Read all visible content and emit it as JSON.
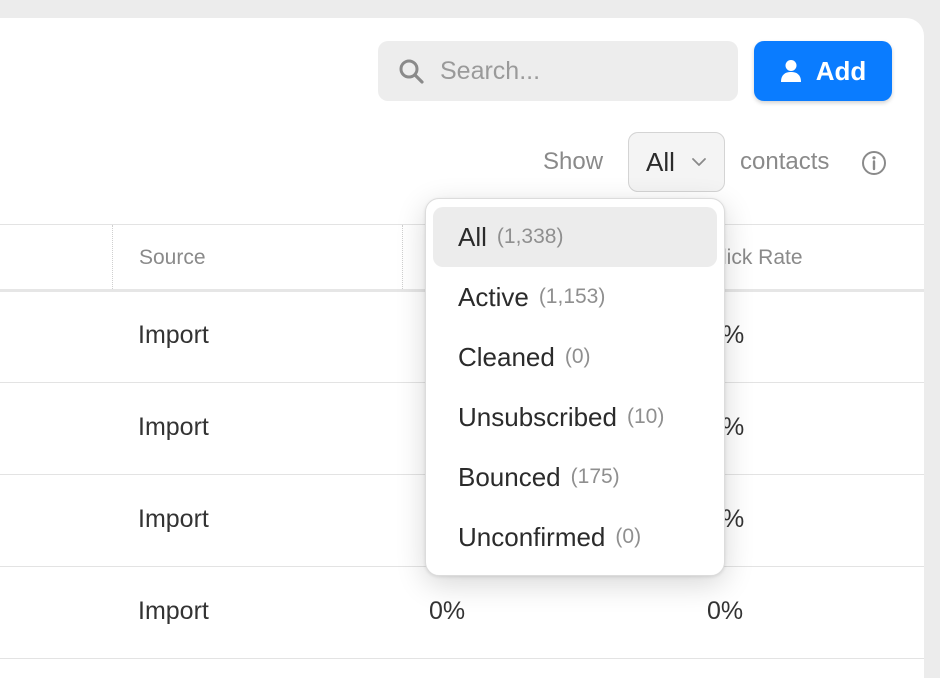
{
  "toolbar": {
    "search_placeholder": "Search...",
    "add_label": "Add",
    "show_label": "Show",
    "select_value": "All",
    "contacts_label": "contacts"
  },
  "table": {
    "headers": [
      "Source",
      "lick Rate"
    ],
    "rows": [
      {
        "source": "Import",
        "rate": "%"
      },
      {
        "source": "Import",
        "rate": "%"
      },
      {
        "source": "Import",
        "rate": "%"
      },
      {
        "source": "Import",
        "open": "0%",
        "rate": "0%"
      }
    ]
  },
  "dropdown": {
    "options": [
      {
        "label": "All",
        "count": "(1,338)",
        "selected": true
      },
      {
        "label": "Active",
        "count": "(1,153)"
      },
      {
        "label": "Cleaned",
        "count": "(0)"
      },
      {
        "label": "Unsubscribed",
        "count": "(10)"
      },
      {
        "label": "Bounced",
        "count": "(175)"
      },
      {
        "label": "Unconfirmed",
        "count": "(0)"
      }
    ]
  },
  "colors": {
    "accent": "#0a7cff",
    "background": "#ececec"
  },
  "icons": [
    "search-icon",
    "person-icon",
    "chevron-down-icon",
    "info-icon"
  ]
}
